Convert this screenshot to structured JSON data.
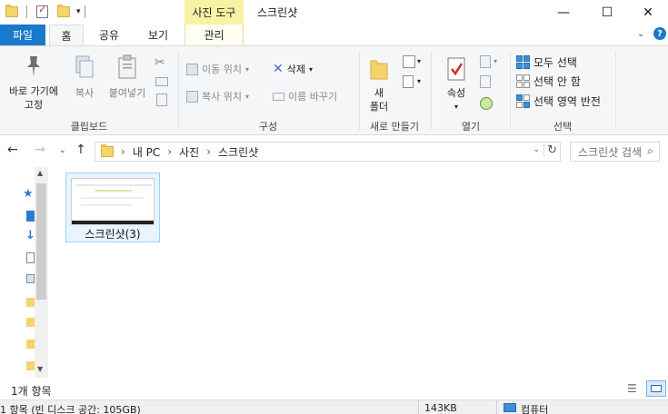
{
  "titlebar": {
    "context_tab": "사진 도구",
    "title": "스크린샷",
    "minimize": "—",
    "maximize": "☐",
    "close": "✕"
  },
  "tabs": {
    "file": "파일",
    "home": "홈",
    "share": "공유",
    "view": "보기",
    "manage": "관리"
  },
  "ribbon": {
    "clipboard": {
      "label": "클립보드",
      "pin_line1": "바로 가기에",
      "pin_line2": "고정",
      "copy": "복사",
      "paste": "붙여넣기"
    },
    "organize": {
      "label": "구성",
      "move_to": "이동 위치",
      "copy_to": "복사 위치",
      "delete": "삭제",
      "rename": "이름 바꾸기"
    },
    "new": {
      "label": "새로 만들기",
      "new_folder_line1": "새",
      "new_folder_line2": "폴더"
    },
    "open": {
      "label": "열기",
      "properties": "속성"
    },
    "select": {
      "label": "선택",
      "select_all": "모두 선택",
      "select_none": "선택 안 함",
      "invert": "선택 영역 반전"
    }
  },
  "address": {
    "crumbs": [
      "내 PC",
      "사진",
      "스크린샷"
    ],
    "search_placeholder": "스크린샷 검색"
  },
  "content": {
    "items": [
      {
        "name": "스크린샷(3)"
      }
    ]
  },
  "status": {
    "count": "1개 항목",
    "disk": "1 항목 (빈 디스크 공간: 105GB)",
    "size": "143KB",
    "location": "컴퓨터"
  },
  "colors": {
    "accent": "#1979ca",
    "context_tab": "#f8f2a5",
    "folder": "#f6d36b",
    "selection": "#e8f4ff"
  }
}
